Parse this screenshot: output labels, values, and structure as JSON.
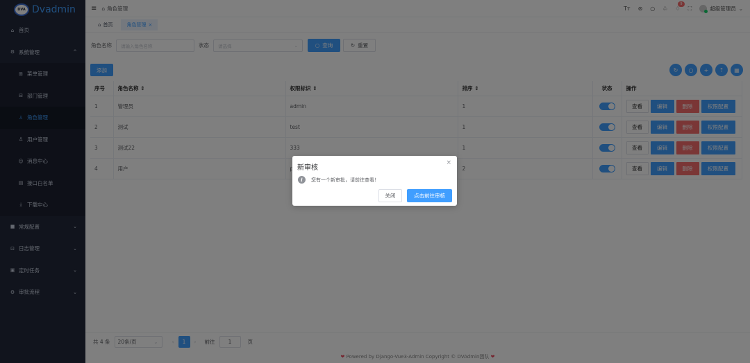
{
  "app": {
    "logo_badge": "DVA",
    "title": "Dvadmin"
  },
  "sidebar": {
    "items": [
      {
        "label": "首页",
        "icon": "home-icon",
        "glyph": "⌂"
      },
      {
        "label": "系统管理",
        "icon": "gear-icon",
        "glyph": "⚙",
        "arrow": "^"
      },
      {
        "label": "菜单管理",
        "icon": "grid-icon",
        "glyph": "⊞"
      },
      {
        "label": "部门管理",
        "icon": "org-icon",
        "glyph": "⊟"
      },
      {
        "label": "角色管理",
        "icon": "role-icon",
        "glyph": "⅄"
      },
      {
        "label": "用户管理",
        "icon": "user-icon",
        "glyph": "♙"
      },
      {
        "label": "消息中心",
        "icon": "message-icon",
        "glyph": "☺"
      },
      {
        "label": "接口白名单",
        "icon": "document-icon",
        "glyph": "▤"
      },
      {
        "label": "下载中心",
        "icon": "download-icon",
        "glyph": "⤓"
      },
      {
        "label": "常规配置",
        "icon": "config-icon",
        "glyph": "■",
        "arrow": "⌄"
      },
      {
        "label": "日志管理",
        "icon": "log-icon",
        "glyph": "⊡",
        "arrow": "⌄"
      },
      {
        "label": "定时任务",
        "icon": "clock-icon",
        "glyph": "▣",
        "arrow": "⌄"
      },
      {
        "label": "审批流程",
        "icon": "flow-icon",
        "glyph": "⚙",
        "arrow": "⌄"
      }
    ]
  },
  "navbar": {
    "breadcrumb": "角色管理",
    "badge_count": "9",
    "user_name": "超级管理员"
  },
  "tabs": [
    {
      "label": "首页"
    },
    {
      "label": "角色管理"
    }
  ],
  "filter": {
    "role_name_label": "角色名称",
    "role_name_placeholder": "请输入角色名称",
    "status_label": "状态",
    "status_placeholder": "请选择",
    "search_label": "查询",
    "reset_label": "重置"
  },
  "toolbar": {
    "add_label": "添加"
  },
  "table": {
    "headers": [
      "序号",
      "角色名称 ⇕",
      "权限标识 ⇕",
      "排序 ⇕",
      "状态",
      "操作"
    ],
    "rows": [
      {
        "no": "1",
        "name": "管理员",
        "key": "admin",
        "sort": "1",
        "status": true
      },
      {
        "no": "2",
        "name": "测试",
        "key": "test",
        "sort": "1",
        "status": true
      },
      {
        "no": "3",
        "name": "测试22",
        "key": "333",
        "sort": "1",
        "status": true
      },
      {
        "no": "4",
        "name": "用户",
        "key": "p",
        "sort": "2",
        "status": true
      }
    ],
    "actions": {
      "view": "查看",
      "edit": "编辑",
      "delete": "删除",
      "perm": "权限配置"
    }
  },
  "pagination": {
    "total": "共 4 条",
    "page_size": "20条/页",
    "current": "1",
    "goto_label": "前往",
    "goto_value": "1",
    "page_suffix": "页"
  },
  "footer": {
    "powered": "Powered by Django-Vue3-Admin Copyright © DVAdmin团队"
  },
  "dialog": {
    "title": "新审核",
    "message": "您有一个新审批，请前往查看！",
    "cancel_label": "关闭",
    "confirm_label": "点击前往审核"
  },
  "colors": {
    "primary": "#409eff",
    "danger": "#f56c6c",
    "sidebar": "#23293a"
  }
}
